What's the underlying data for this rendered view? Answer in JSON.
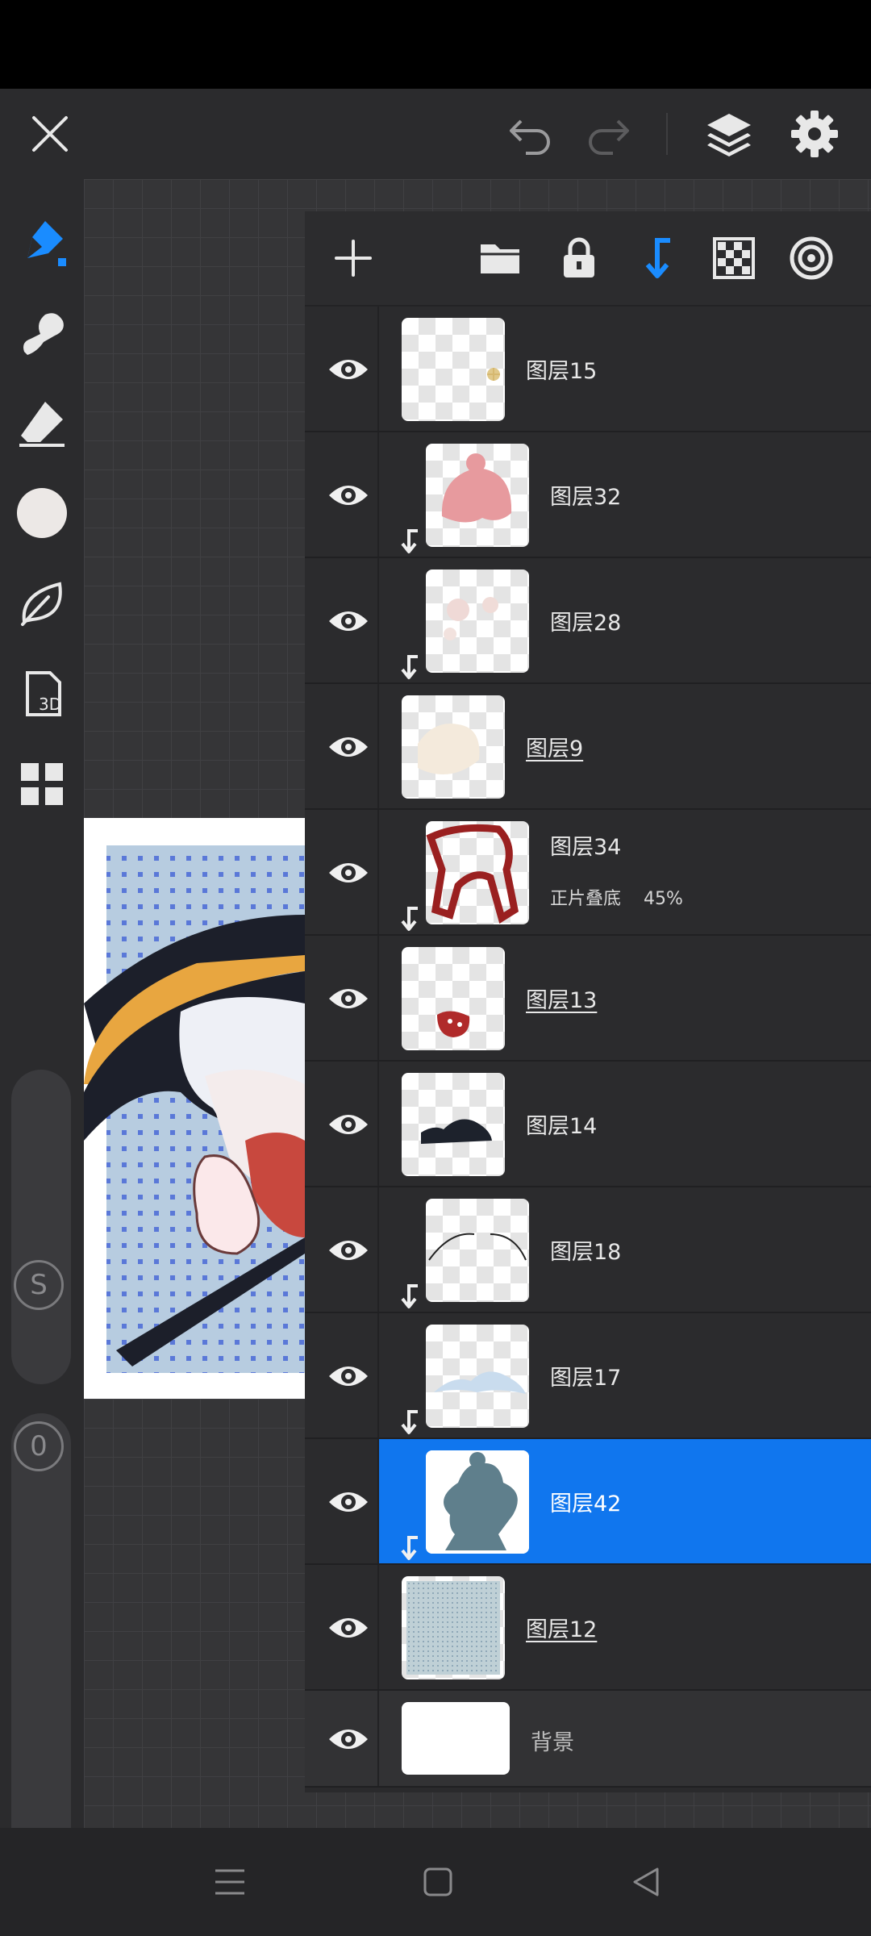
{
  "app": {
    "top_bar": {
      "close_icon": "close-icon",
      "undo_icon": "undo-icon",
      "redo_icon": "redo-icon",
      "layers_icon": "layers-icon",
      "settings_icon": "gear-icon"
    },
    "left_tools": [
      "brush-icon",
      "smudge-icon",
      "eraser-icon",
      "color-swatch",
      "leaf-icon",
      "3d-icon",
      "grid-icon"
    ],
    "sliders": {
      "size_label": "S",
      "opacity_label": "0"
    },
    "accent_color": "#1076ee",
    "layers_toolbar": [
      "add-icon",
      "folder-icon",
      "lock-icon",
      "clip-icon",
      "transparency-icon",
      "target-icon"
    ],
    "layers": [
      {
        "name": "图层15",
        "clipped": false,
        "underline": false
      },
      {
        "name": "图层32",
        "clipped": true,
        "underline": false
      },
      {
        "name": "图层28",
        "clipped": true,
        "underline": false
      },
      {
        "name": "图层9",
        "clipped": false,
        "underline": true
      },
      {
        "name": "图层34",
        "clipped": true,
        "underline": false,
        "blend": "正片叠底",
        "opacity": "45%"
      },
      {
        "name": "图层13",
        "clipped": false,
        "underline": true
      },
      {
        "name": "图层14",
        "clipped": false,
        "underline": false
      },
      {
        "name": "图层18",
        "clipped": true,
        "underline": false
      },
      {
        "name": "图层17",
        "clipped": true,
        "underline": false
      },
      {
        "name": "图层42",
        "clipped": true,
        "underline": false,
        "selected": true
      },
      {
        "name": "图层12",
        "clipped": false,
        "underline": true
      },
      {
        "name": "背景",
        "clipped": false,
        "underline": false,
        "background": true
      }
    ]
  }
}
